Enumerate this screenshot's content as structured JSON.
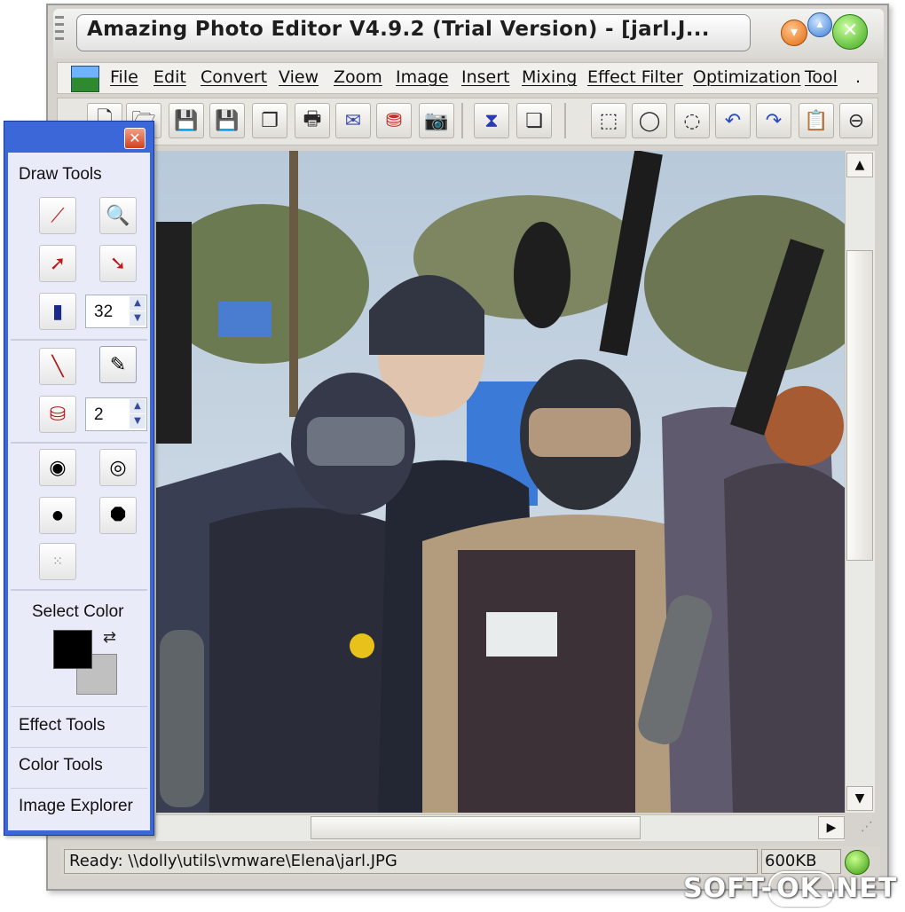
{
  "window": {
    "title": "Amazing Photo Editor V4.9.2 (Trial Version) - [jarl.J..."
  },
  "menu": [
    "File",
    "Edit",
    "Convert",
    "View",
    "Zoom",
    "Image",
    "Insert",
    "Mixing",
    "Effect Filter",
    "Optimization",
    "Tool"
  ],
  "menu_more": ".",
  "panel": {
    "draw_tools_label": "Draw Tools",
    "brush_size": "32",
    "line_width": "2",
    "select_color_label": "Select Color",
    "effect_tools_label": "Effect Tools",
    "color_tools_label": "Color Tools",
    "image_explorer_label": "Image Explorer",
    "foreground_color": "#000000",
    "background_color": "#c0c0c0"
  },
  "status": {
    "path": "Ready: \\\\dolly\\utils\\vmware\\Elena\\jarl.JPG",
    "size": "600KB"
  },
  "watermark": {
    "left": "SOFT-",
    "ok": "OK",
    "right": ".NET"
  },
  "colors": {
    "panel_border": "#3b67d8",
    "status_led": "#3a9a10"
  }
}
